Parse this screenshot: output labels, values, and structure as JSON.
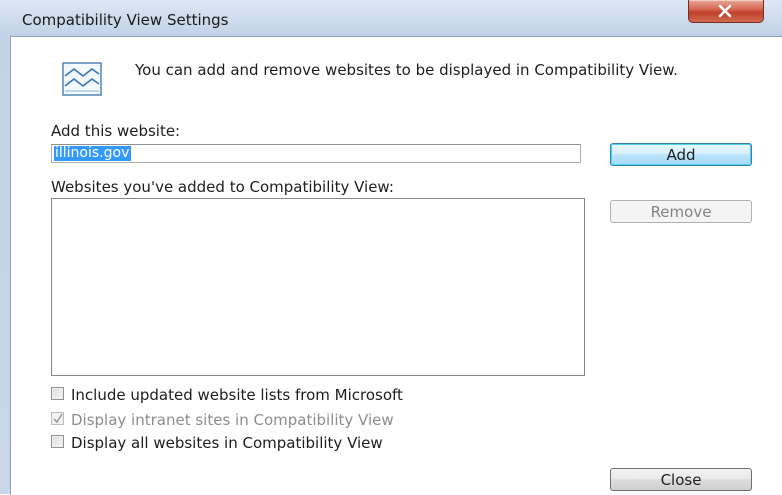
{
  "window": {
    "title": "Compatibility View Settings"
  },
  "info": {
    "icon": "compatibility-view-icon",
    "text": "You can add and remove websites to be displayed in Compatibility View."
  },
  "add_section": {
    "label": "Add this website:",
    "input_value": "illinois.gov",
    "add_button": "Add"
  },
  "list_section": {
    "label": "Websites you've added to Compatibility View:",
    "items": [],
    "remove_button": "Remove"
  },
  "options": [
    {
      "label": "Include updated website lists from Microsoft",
      "checked": false,
      "enabled": true
    },
    {
      "label": "Display intranet sites in Compatibility View",
      "checked": true,
      "enabled": false
    },
    {
      "label": "Display all websites in Compatibility View",
      "checked": false,
      "enabled": true
    }
  ],
  "footer": {
    "close_button": "Close"
  },
  "colors": {
    "selection": "#3399ff",
    "close_red": "#c0402a",
    "frame": "#c3d3e7"
  }
}
